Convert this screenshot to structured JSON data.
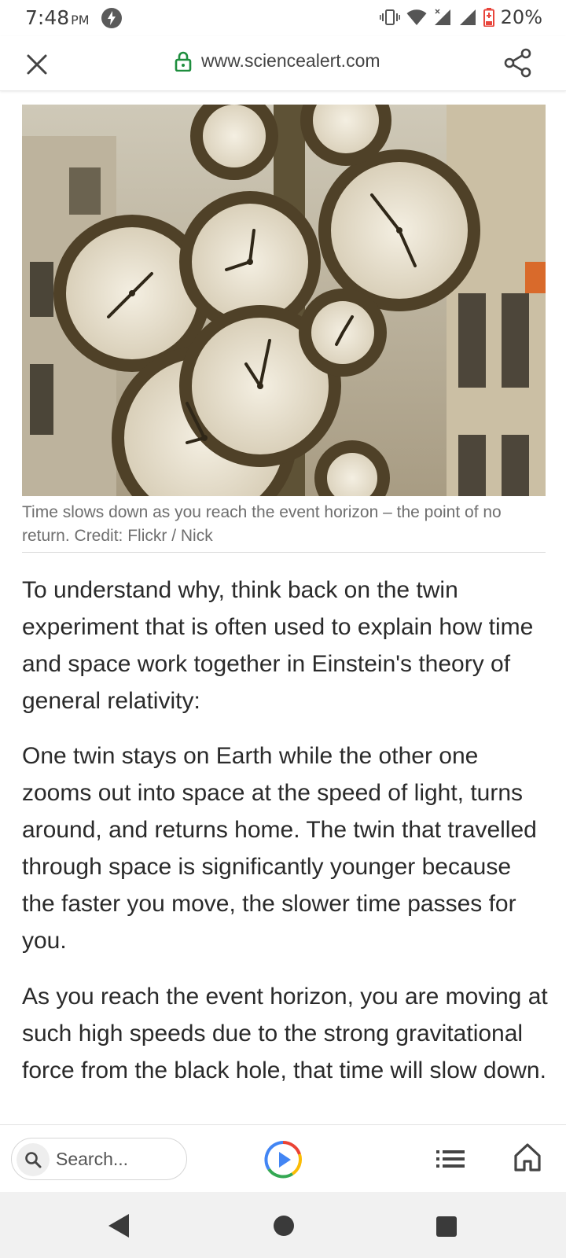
{
  "status_bar": {
    "time": "7:48",
    "ampm": "PM",
    "battery": "20%"
  },
  "toolbar": {
    "url": "www.sciencealert.com"
  },
  "article": {
    "image_caption": "Time slows down as you reach the event horizon – the point of no return. Credit: Flickr / Nick",
    "paragraphs": [
      "To understand why, think back on the twin experiment that is often used to explain how time and space work together in Einstein's theory of general relativity:",
      "One twin stays on Earth while the other one zooms out into space at the speed of light, turns around, and returns home. The twin that travelled through space is significantly younger because the faster you move, the slower time passes for you.",
      "As you reach the event horizon, you are moving at such high speeds due to the strong gravitational force from the black hole, that time will slow down."
    ]
  },
  "bottom_bar": {
    "search_placeholder": "Search..."
  },
  "colors": {
    "lock_green": "#1e8e3e",
    "battery_red": "#e8453c",
    "assistant_blue": "#4285f4",
    "assistant_red": "#ea4335",
    "assistant_yellow": "#fbbc05",
    "assistant_green": "#34a853"
  },
  "icons": {
    "status": [
      "sync-icon",
      "vibrate-icon",
      "wifi-icon",
      "signal-icon",
      "signal-icon",
      "battery-icon"
    ],
    "toolbar": [
      "close-icon",
      "lock-icon",
      "share-icon"
    ],
    "bottom_bar": [
      "search-icon",
      "assistant-icon",
      "list-icon",
      "home-icon"
    ],
    "nav": [
      "back-icon",
      "home-circle-icon",
      "recents-icon"
    ]
  }
}
